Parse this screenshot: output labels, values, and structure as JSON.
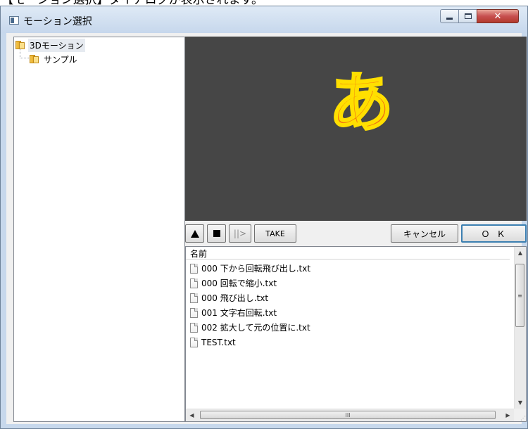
{
  "caption": "【モーション選択】ダイアログが表示されます。",
  "window": {
    "title": "モーション選択",
    "minimize_glyph": "",
    "close_glyph": "✕"
  },
  "tree": {
    "root_label": "3Dモーション",
    "child_label": "サンプル"
  },
  "preview": {
    "glyph": "あ",
    "colors": {
      "background": "#464646",
      "fill": "#f07412",
      "outline": "#ffdf00"
    }
  },
  "toolbar": {
    "play_icon": "play-up-triangle",
    "stop_icon": "stop-square",
    "step_label": "||>",
    "take_label": "TAKE",
    "cancel_label": "キャンセル",
    "ok_label": "ＯＫ"
  },
  "file_list": {
    "column_header": "名前",
    "items": [
      "000 下から回転飛び出し.txt",
      "000 回転で縮小.txt",
      "000 飛び出し.txt",
      "001 文字右回転.txt",
      "002 拡大して元の位置に.txt",
      "TEST.txt"
    ]
  },
  "scroll": {
    "up": "▲",
    "down": "▼",
    "left": "◀",
    "right": "▶",
    "v_grip": "≡",
    "h_grip": "III"
  }
}
